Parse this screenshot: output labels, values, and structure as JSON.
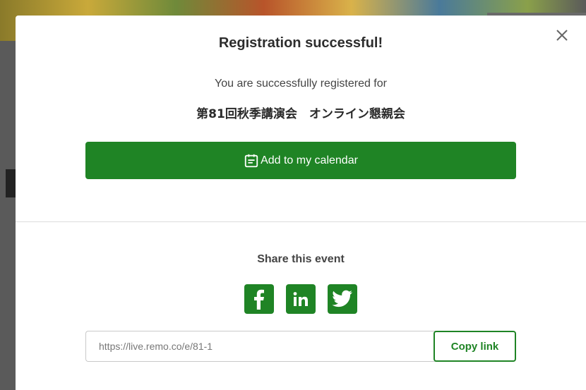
{
  "modal": {
    "title": "Registration successful!",
    "subtitle": "You are successfully registered for",
    "event_name": "第81回秋季講演会　オンライン懇親会",
    "calendar_button_label": "Add to my calendar",
    "share_title": "Share this event",
    "social_icons": [
      "facebook-icon",
      "linkedin-icon",
      "twitter-icon"
    ],
    "link_value": "https://live.remo.co/e/81-1",
    "copy_button_label": "Copy link"
  },
  "colors": {
    "accent": "#1f8425",
    "overlay": "#5a5a5a"
  }
}
